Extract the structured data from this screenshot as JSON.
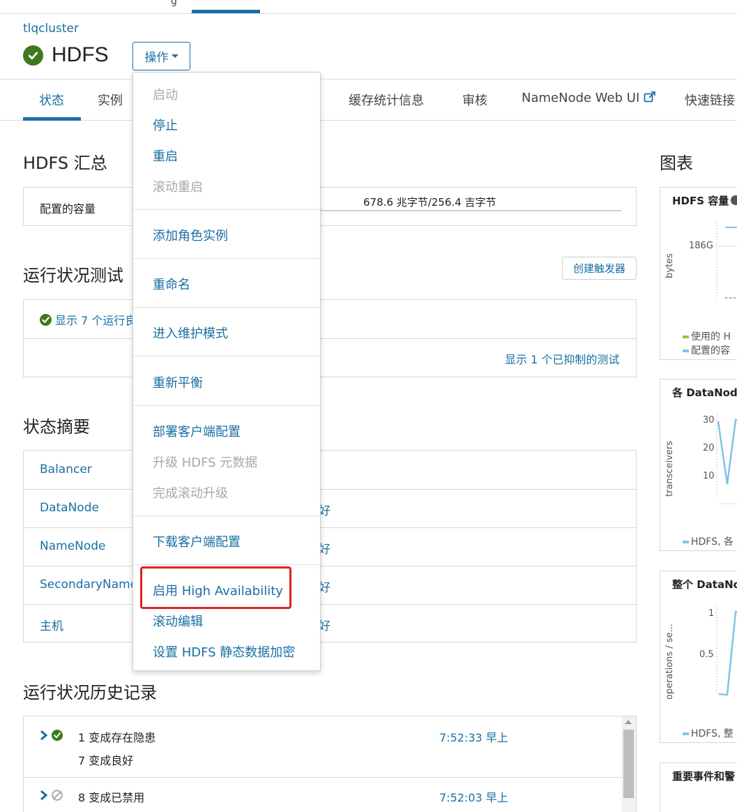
{
  "topnav": {
    "fragment": "g"
  },
  "cluster_link": "tlqcluster",
  "service": {
    "name": "HDFS",
    "status_icon": "check-circle-icon",
    "actions_label": "操作"
  },
  "tabs": [
    "状态",
    "实例",
    "缓存统计信息",
    "审核",
    "NameNode Web UI",
    "快速链接"
  ],
  "summary": {
    "title": "HDFS 汇总",
    "capacity_label": "配置的容量",
    "capacity_value": "678.6 兆字节/256.4 吉字节"
  },
  "health_tests": {
    "title": "运行状况测试",
    "create_trigger": "创建触发器",
    "show_running": "显示 7 个运行良",
    "show_suppressed": "显示 1 个已抑制的测试"
  },
  "status_summary": {
    "title": "状态摘要",
    "rows": [
      {
        "name": "Balancer",
        "status": ""
      },
      {
        "name": "DataNode",
        "status": "好"
      },
      {
        "name": "NameNode",
        "status": "好"
      },
      {
        "name": "SecondaryNameN",
        "status": "好"
      },
      {
        "name": "主机",
        "status": "好"
      }
    ]
  },
  "history": {
    "title": "运行状况历史记录",
    "rows": [
      {
        "line1": "1 变成存在隐患",
        "line2": "7 变成良好",
        "time": "7:52:33 早上"
      },
      {
        "line1": "8 变成已禁用",
        "line2": "",
        "time": "7:52:03 早上"
      }
    ]
  },
  "charts": {
    "title": "图表",
    "items": [
      {
        "title": "HDFS 容量",
        "ylabel": "bytes",
        "ticks": [
          "186G"
        ],
        "legend": [
          "使用的 H",
          "配置的容"
        ],
        "colors": [
          "#8dc63f",
          "#7fc4e6"
        ]
      },
      {
        "title": "各 DataNode",
        "ylabel": "transceivers",
        "ticks": [
          "30",
          "20",
          "10"
        ],
        "legend": [
          "HDFS, 各"
        ],
        "colors": [
          "#7fc4e6"
        ]
      },
      {
        "title": "整个 DataNo",
        "ylabel": "operations / se...",
        "ticks": [
          "1",
          "0.5"
        ],
        "legend": [
          "HDFS, 整"
        ],
        "colors": [
          "#7fc4e6"
        ]
      },
      {
        "title": "重要事件和警"
      }
    ]
  },
  "menu": {
    "items": [
      {
        "label": "启动",
        "disabled": true
      },
      {
        "label": "停止",
        "disabled": false
      },
      {
        "label": "重启",
        "disabled": false
      },
      {
        "label": "滚动重启",
        "disabled": true
      },
      {
        "label": "添加角色实例",
        "disabled": false
      },
      {
        "label": "重命名",
        "disabled": false
      },
      {
        "label": "进入维护模式",
        "disabled": false
      },
      {
        "label": "重新平衡",
        "disabled": false
      },
      {
        "label": "部署客户端配置",
        "disabled": false
      },
      {
        "label": "升级 HDFS 元数据",
        "disabled": true
      },
      {
        "label": "完成滚动升级",
        "disabled": true
      },
      {
        "label": "下载客户端配置",
        "disabled": false
      },
      {
        "label": "启用 High Availability",
        "disabled": false
      },
      {
        "label": "滚动编辑",
        "disabled": false
      },
      {
        "label": "设置 HDFS 静态数据加密",
        "disabled": false
      }
    ]
  },
  "colors": {
    "accent": "#1a6fa3",
    "ok": "#3d7a1e",
    "highlight": "#e02020"
  }
}
